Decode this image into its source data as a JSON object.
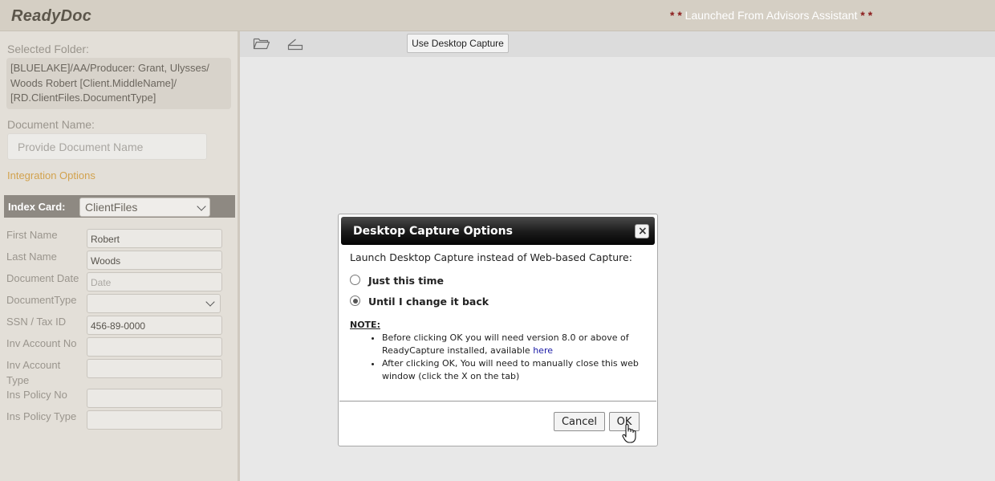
{
  "header": {
    "brand": "ReadyDoc",
    "launched_stars_left": "* *",
    "launched_text": " Launched From Advisors Assistant ",
    "launched_stars_right": "* *"
  },
  "sidebar": {
    "selected_folder_label": "Selected Folder:",
    "selected_folder_path": "[BLUELAKE]/AA/Producer: Grant, Ulysses/ Woods Robert [Client.MiddleName]/ [RD.ClientFiles.DocumentType]",
    "document_name_label": "Document Name:",
    "document_name_placeholder": "Provide Document Name",
    "integration_options": "Integration Options",
    "index_card_label": "Index Card:",
    "index_card_value": "ClientFiles",
    "fields": [
      {
        "label": "First Name",
        "value": "Robert"
      },
      {
        "label": "Last Name",
        "value": "Woods"
      },
      {
        "label": "Document Date",
        "placeholder": "Date"
      },
      {
        "label": "DocumentType",
        "value": ""
      },
      {
        "label": "SSN / Tax ID",
        "value": "456-89-0000"
      },
      {
        "label": "Inv Account No",
        "value": ""
      },
      {
        "label": "Inv Account Type",
        "value": ""
      },
      {
        "label": "Ins Policy No",
        "value": ""
      },
      {
        "label": "Ins Policy Type",
        "value": ""
      }
    ]
  },
  "toolbar": {
    "open_icon": "folder-open-icon",
    "scan_icon": "scanner-icon",
    "desktop_capture_button": "Use Desktop Capture"
  },
  "dialog": {
    "title": "Desktop Capture Options",
    "close_glyph": "×",
    "prompt": "Launch Desktop Capture instead of Web-based Capture:",
    "options": [
      {
        "label": "Just this time",
        "selected": false
      },
      {
        "label": "Until I change it back",
        "selected": true
      }
    ],
    "note_heading": "NOTE:",
    "note_1_text": "Before clicking OK you will need version 8.0 or above of ReadyCapture installed, available ",
    "note_1_link": "here",
    "note_2_text": "After clicking OK, You will need to manually close this web window (click the X on the tab)",
    "cancel_label": "Cancel",
    "ok_label": "OK"
  },
  "colors": {
    "header_bg": "#d5cfc4",
    "sidebar_bg": "#e3dfd8",
    "index_bar_bg": "#8e8982",
    "accent_orange": "#d2a24e",
    "star_red": "#8b1a1a",
    "link_blue": "#1a1aa6"
  }
}
